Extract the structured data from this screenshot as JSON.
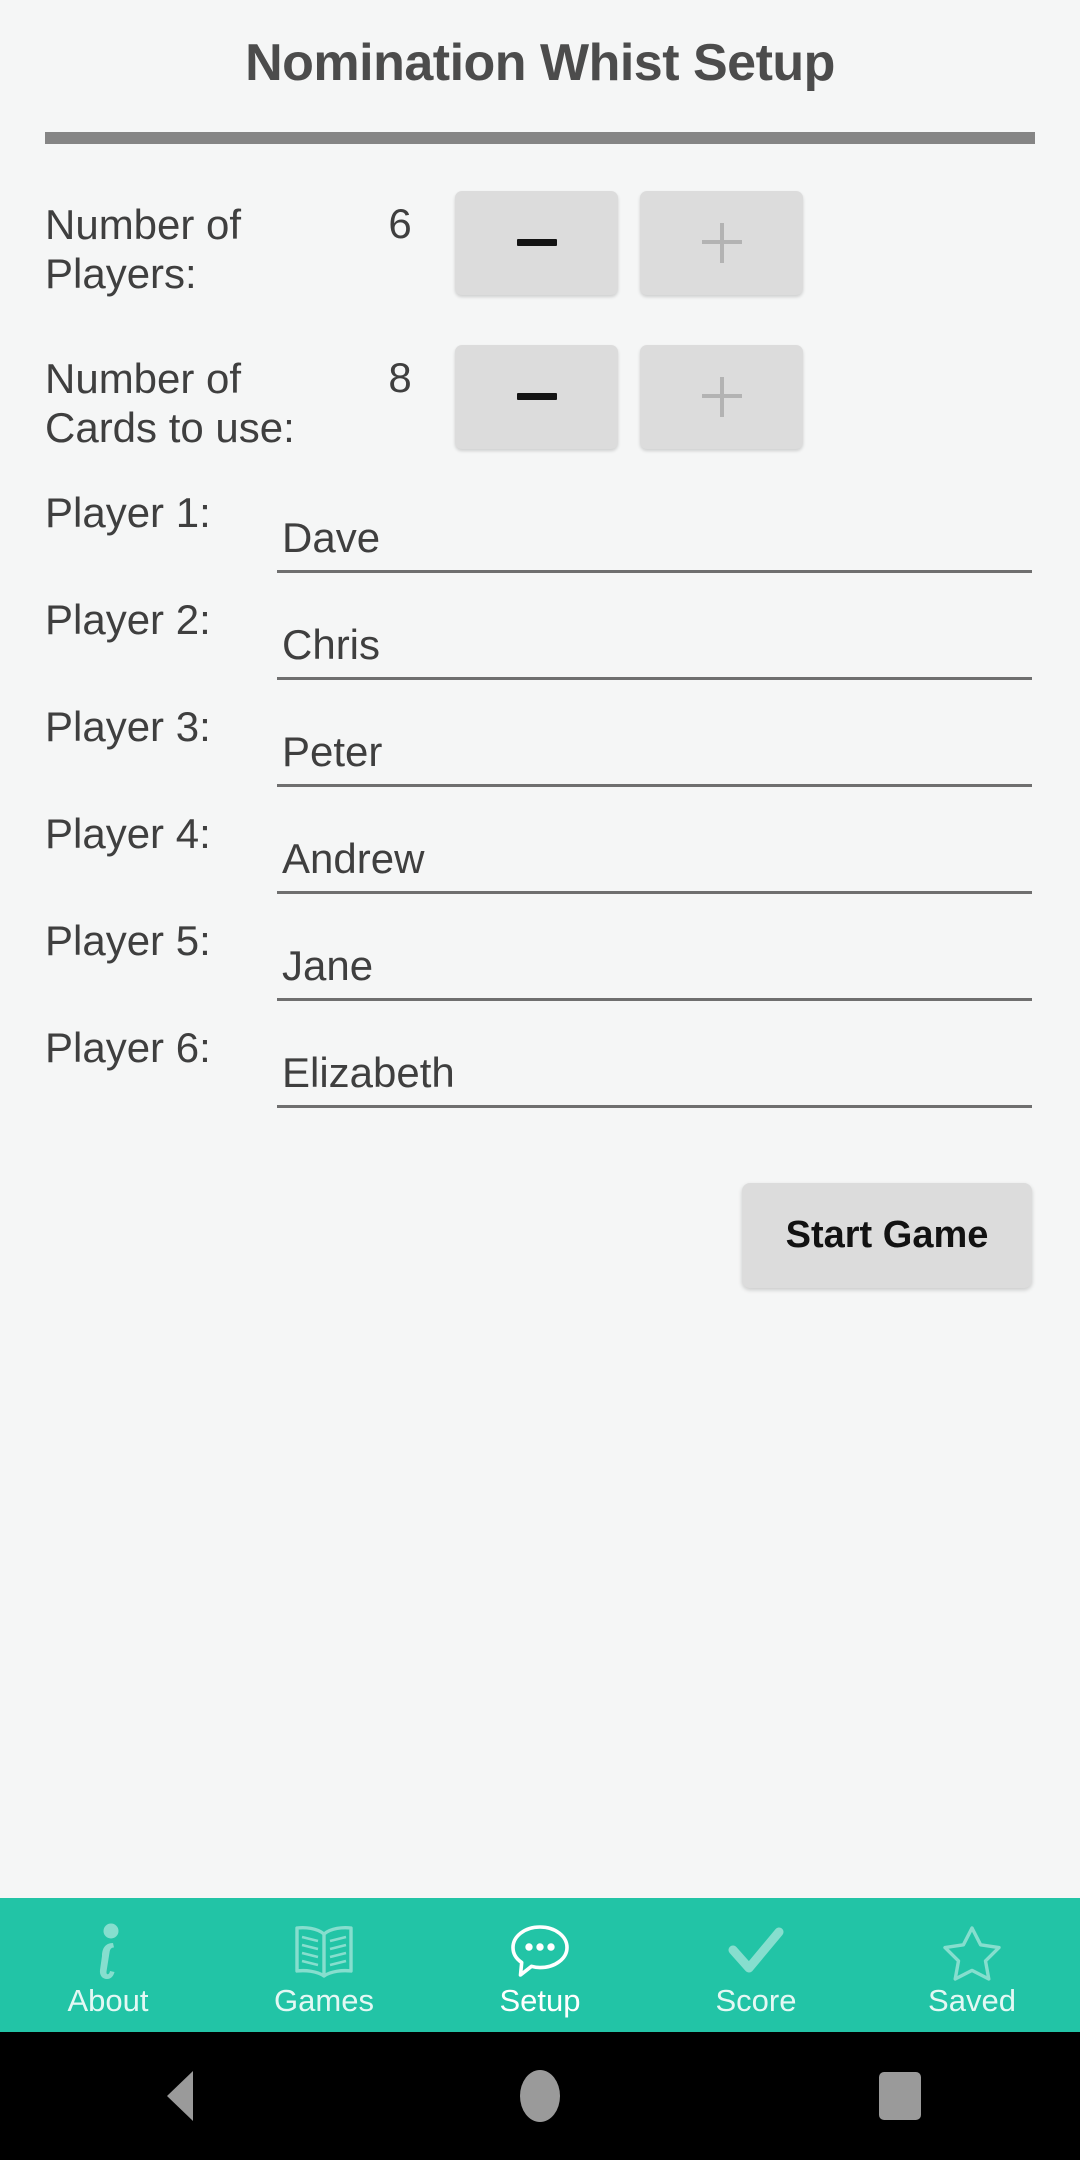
{
  "header": {
    "title": "Nomination Whist Setup"
  },
  "settings": {
    "players": {
      "label": "Number of Players:",
      "value": "6",
      "decrement_label": "−",
      "increment_label": "+",
      "decrement_enabled": true,
      "increment_enabled": false
    },
    "cards": {
      "label": "Number of Cards to use:",
      "value": "8",
      "decrement_label": "−",
      "increment_label": "+",
      "decrement_enabled": true,
      "increment_enabled": false
    }
  },
  "players": [
    {
      "label": "Player 1:",
      "name": "Dave"
    },
    {
      "label": "Player 2:",
      "name": "Chris"
    },
    {
      "label": "Player 3:",
      "name": "Peter"
    },
    {
      "label": "Player 4:",
      "name": "Andrew"
    },
    {
      "label": "Player 5:",
      "name": "Jane"
    },
    {
      "label": "Player 6:",
      "name": "Elizabeth"
    }
  ],
  "actions": {
    "start_label": "Start Game"
  },
  "bottom_nav": {
    "active": "Setup",
    "items": [
      {
        "label": "About",
        "icon": "info-icon"
      },
      {
        "label": "Games",
        "icon": "book-icon"
      },
      {
        "label": "Setup",
        "icon": "speech-bubble-icon"
      },
      {
        "label": "Score",
        "icon": "check-icon"
      },
      {
        "label": "Saved",
        "icon": "star-icon"
      }
    ]
  },
  "system_bar": {
    "back_label": "Back",
    "home_label": "Home",
    "recents_label": "Recents"
  },
  "colors": {
    "accent": "#22c4a6",
    "background": "#f5f6f6",
    "button": "#dcdcdc",
    "text": "#3f3f3f",
    "rule": "#858585"
  }
}
